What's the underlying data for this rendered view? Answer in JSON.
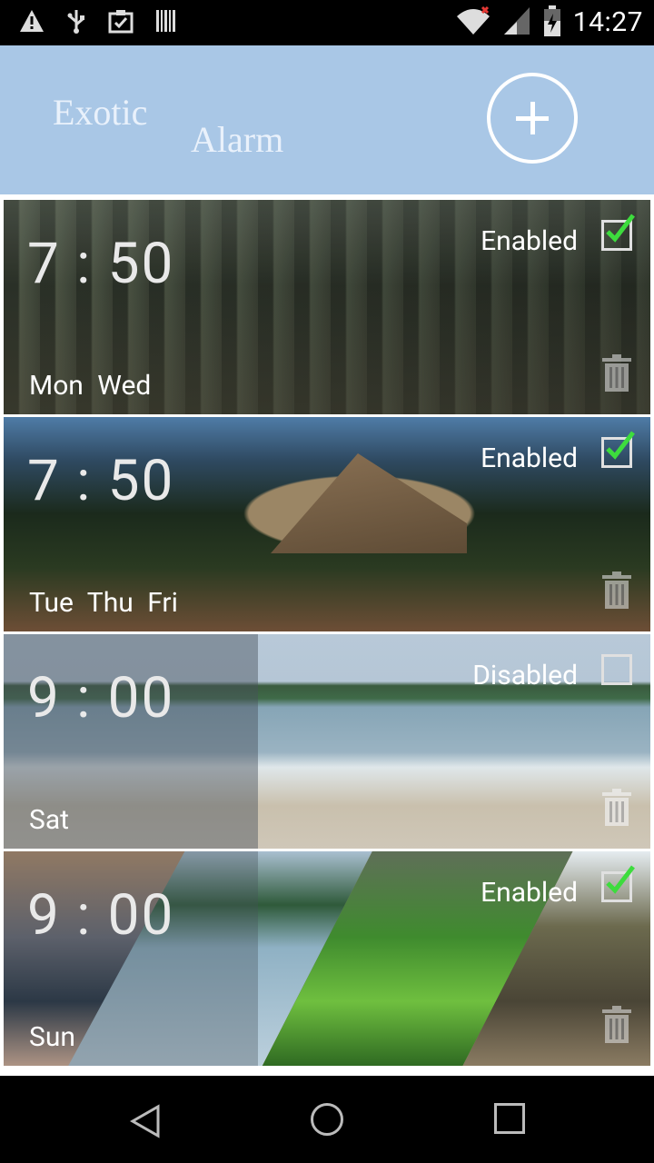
{
  "status_bar": {
    "time": "14:27",
    "icons_left": [
      "warning-icon",
      "usb-icon",
      "clipboard-check-icon",
      "barcode-icon"
    ],
    "icons_right": [
      "wifi-icon",
      "signal-icon",
      "battery-icon"
    ]
  },
  "header": {
    "logo_line1": "Exotic",
    "logo_line2": "Alarm"
  },
  "alarms": [
    {
      "time": "7 : 50",
      "days": "Mon Wed",
      "state": "Enabled",
      "checked": true
    },
    {
      "time": "7 : 50",
      "days": "Tue Thu Fri",
      "state": "Enabled",
      "checked": true
    },
    {
      "time": "9 : 00",
      "days": "Sat",
      "state": "Disabled",
      "checked": false
    },
    {
      "time": "9 : 00",
      "days": "Sun",
      "state": "Enabled",
      "checked": true
    }
  ],
  "colors": {
    "appbar": "#a9c7e6",
    "check": "#3ddc3d"
  }
}
